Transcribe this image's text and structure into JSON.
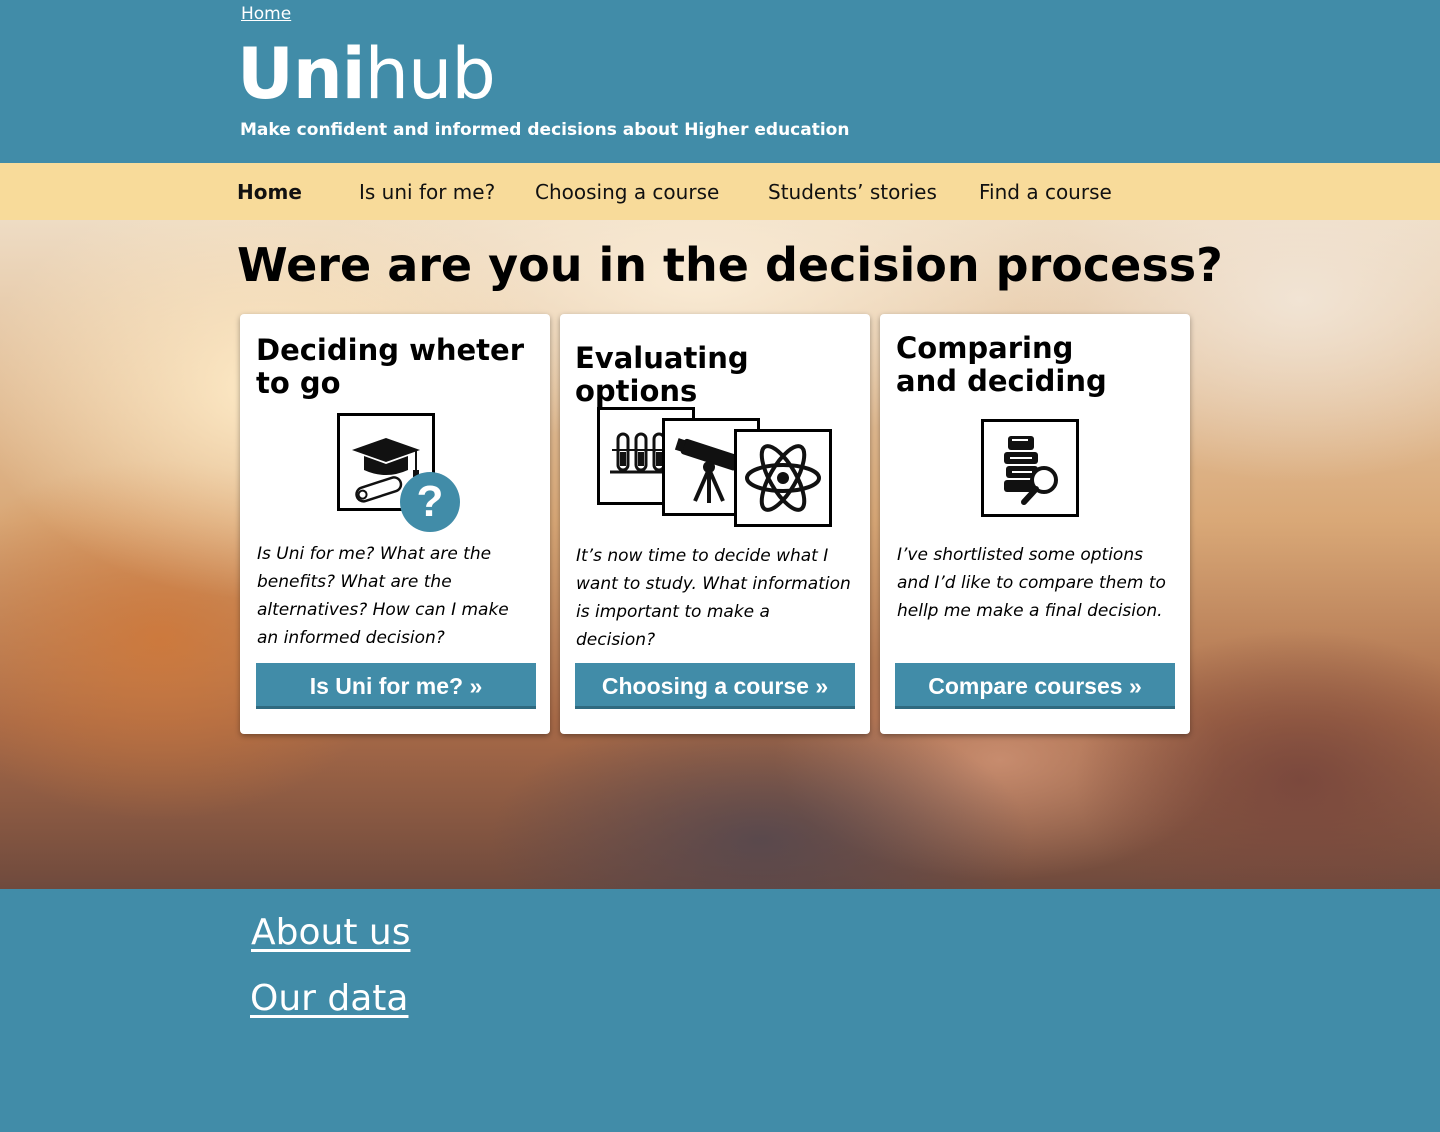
{
  "header": {
    "breadcrumb": "Home",
    "logo_bold": "Uni",
    "logo_light": "hub",
    "tagline": "Make confident and informed decisions about Higher education"
  },
  "nav": {
    "items": [
      {
        "label": "Home",
        "active": true
      },
      {
        "label": "Is uni for me?",
        "active": false
      },
      {
        "label": "Choosing a course",
        "active": false
      },
      {
        "label": "Students’ stories",
        "active": false
      },
      {
        "label": "Find a course",
        "active": false
      }
    ]
  },
  "hero": {
    "title": "Were are you in the decision process?"
  },
  "cards": [
    {
      "title_line1": "Deciding wheter",
      "title_line2": "to go",
      "icon": "graduation-cap-question-icon",
      "badge": "?",
      "text": "Is Uni for me? What are the benefits? What are the alternatives? How can I make an informed decision?",
      "button": "Is Uni for me?  »"
    },
    {
      "title_line1": "Evaluating options",
      "title_line2": "",
      "icon": "science-icons",
      "text": "It’s now time to decide what I want to study. What information is important to make a decision?",
      "button": "Choosing a course »"
    },
    {
      "title_line1": "Comparing",
      "title_line2": "and deciding",
      "icon": "books-magnifier-icon",
      "text": "I’ve shortlisted some options and I’d like to compare them to hellp me make a final decision.",
      "button": "Compare courses »"
    }
  ],
  "footer": {
    "about": "About us",
    "data": "Our data"
  },
  "colors": {
    "brand": "#418ca8",
    "nav_bg": "#f8db9a",
    "card_bg": "#ffffff"
  }
}
